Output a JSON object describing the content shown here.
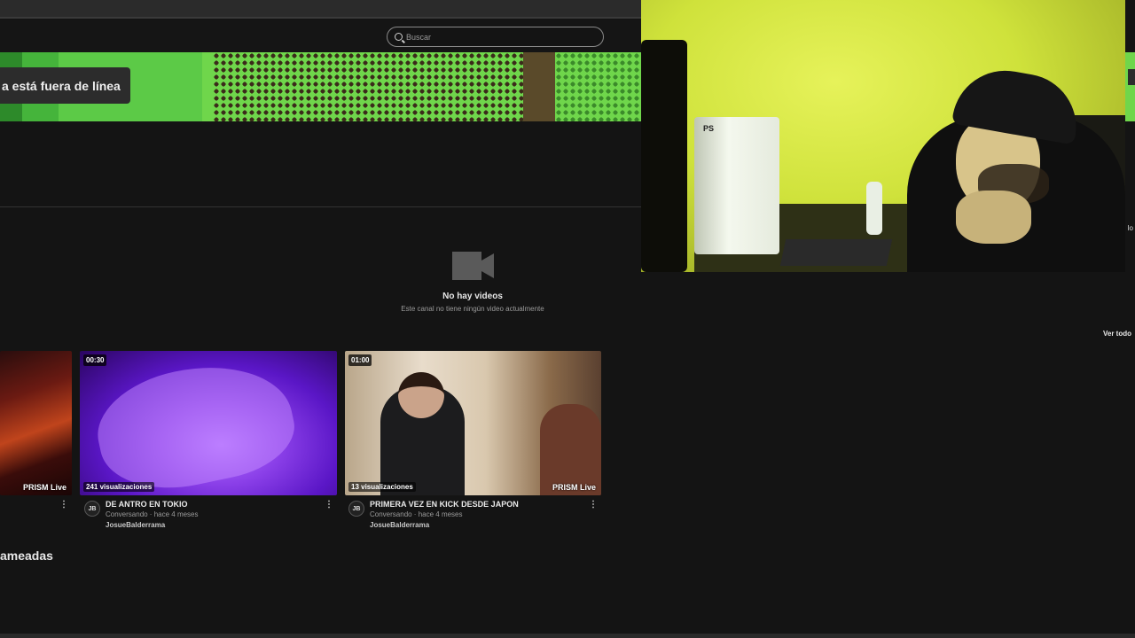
{
  "header": {
    "search_placeholder": "Buscar"
  },
  "banner": {
    "offline_text": "a está fuera de línea"
  },
  "videos_section": {
    "empty_title": "No hay videos",
    "empty_subtitle": "Este canal no tiene ningún video actualmente",
    "see_all": "Ver todo"
  },
  "right_edge_text": "lo",
  "clips": [
    {
      "duration": "",
      "views": "",
      "prism": "PRISM Live"
    },
    {
      "duration": "00:30",
      "views": "241 visualizaciones",
      "title": "DE ANTRO EN TOKIO",
      "category_time": "Conversando · hace 4 meses",
      "channel": "JosueBalderrama",
      "avatar_initials": "JB"
    },
    {
      "duration": "01:00",
      "views": "13 visualizaciones",
      "prism": "PRISM Live",
      "title": "PRIMERA VEZ EN KICK DESDE JAPON",
      "category_time": "Conversando · hace 4 meses",
      "channel": "JosueBalderrama",
      "avatar_initials": "JB"
    }
  ],
  "kebab_glyph": "⋮",
  "section_heading": "ameadas",
  "webcam": {
    "console_logo": "PS"
  },
  "colors": {
    "background": "#141414",
    "banner_green": "#6fd64b",
    "webcam_tint": "#cfe23b"
  }
}
